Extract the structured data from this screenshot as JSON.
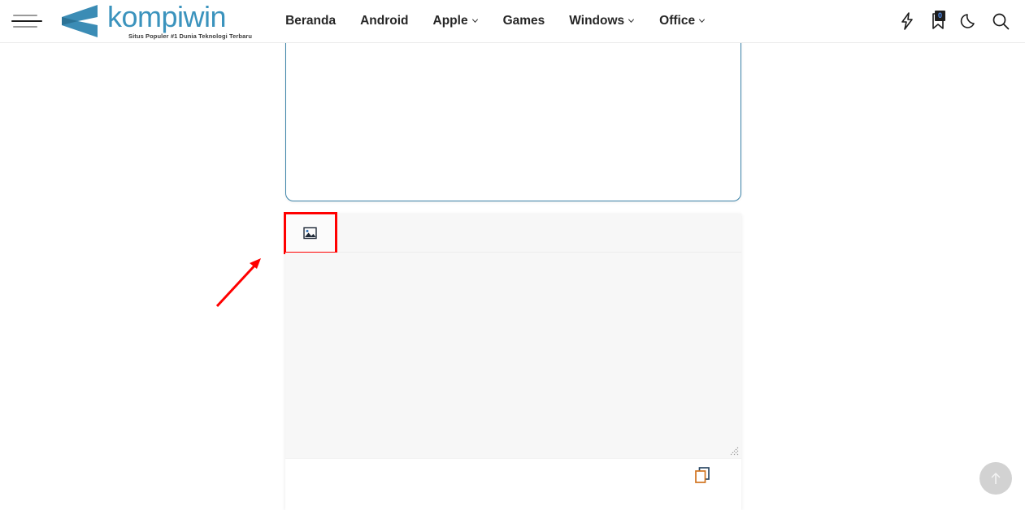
{
  "header": {
    "menu_icon": "hamburger-menu-icon",
    "brand": {
      "name": "kompiwin",
      "tagline": "Situs Populer #1 Dunia Teknologi Terbaru",
      "logo_icon": "kompiwin-logo-icon",
      "brand_color": "#3b93bd"
    },
    "nav": [
      {
        "label": "Beranda",
        "has_dropdown": false
      },
      {
        "label": "Android",
        "has_dropdown": false
      },
      {
        "label": "Apple",
        "has_dropdown": true
      },
      {
        "label": "Games",
        "has_dropdown": false
      },
      {
        "label": "Windows",
        "has_dropdown": true
      },
      {
        "label": "Office",
        "has_dropdown": true
      }
    ],
    "actions": {
      "flash_icon": "lightning-bolt-icon",
      "bookmark_icon": "bookmark-icon",
      "bookmark_count": "0",
      "dark_mode_icon": "moon-icon",
      "search_icon": "search-icon"
    }
  },
  "main": {
    "top_embed": {
      "name": "embedded-content-frame",
      "border_color": "#3b82a8"
    },
    "tool_panel": {
      "toolbar": {
        "buttons": [
          {
            "icon": "insert-image-icon",
            "highlighted": true
          }
        ],
        "highlight_color": "#ff0000"
      },
      "editor": {
        "value": "",
        "placeholder": "",
        "resize_handle_icon": "resize-grip-icon"
      },
      "footer": {
        "copy_icon": "copy-icon"
      }
    },
    "annotation": {
      "arrow_icon": "red-arrow-icon",
      "color": "#ff0000"
    }
  },
  "scroll_top": {
    "icon": "arrow-up-icon",
    "background": "#d2d2d2"
  }
}
